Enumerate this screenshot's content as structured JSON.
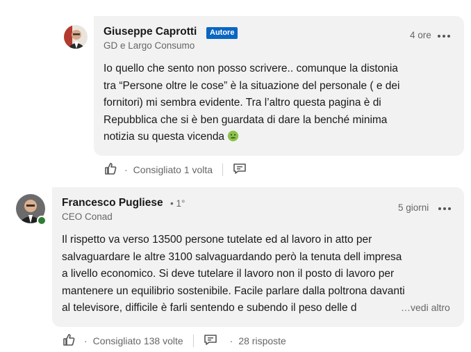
{
  "comments": [
    {
      "author": "Giuseppe Caprotti",
      "badge": "Autore",
      "subtitle": "GD e Largo Consumo",
      "time": "4 ore",
      "body": [
        "Io quello che sento non posso scrivere.. comunque la distonia",
        "tra “Persone oltre le cose” è la situazione del personale ( e dei",
        "fornitori) mi sembra evidente. Tra l’altro questa pagina è di",
        "Repubblica che si è ben guardata di dare la benché minima",
        "notizia su questa vicenda"
      ],
      "emoji": "nauseated-face-icon",
      "likes": "Consigliato 1 volta",
      "dot": "·"
    },
    {
      "author": "Francesco Pugliese",
      "degree": "• 1°",
      "subtitle": "CEO Conad",
      "time": "5 giorni",
      "body": [
        "Il rispetto va verso 13500 persone tutelate ed al lavoro in atto per",
        "salvaguardare le altre 3100 salvaguardando però la tenuta dell impresa",
        "a livello economico. Si deve tutelare il lavoro non il posto di lavoro per",
        "mantenere un equilibrio sostenibile. Facile parlare dalla poltrona davanti",
        "al televisore, difficile è farli sentendo e subendo il peso delle d"
      ],
      "see_more": "…vedi altro",
      "likes": "Consigliato 138 volte",
      "replies": "28 risposte",
      "dot": "·",
      "status": "online"
    }
  ],
  "colors": {
    "bubble": "#f2f2f2",
    "badge": "#0a66c2",
    "online": "#2e7d32",
    "muted": "#666666"
  }
}
